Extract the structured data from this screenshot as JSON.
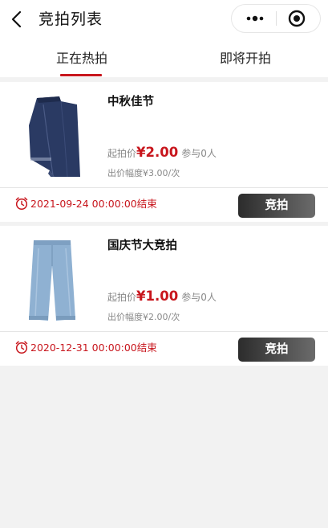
{
  "nav": {
    "title": "竞拍列表"
  },
  "tabs": [
    {
      "label": "正在热拍",
      "active": true
    },
    {
      "label": "即将开拍",
      "active": false
    }
  ],
  "items": [
    {
      "name": "中秋佳节",
      "start_price_label": "起拍价",
      "price": "¥2.00",
      "participants": "参与0人",
      "increment": "出价幅度¥3.00/次",
      "end_time": "2021-09-24 00:00:00结束",
      "bid_label": "竞拍",
      "image_icon": "dark-denim-skirt-image"
    },
    {
      "name": "国庆节大竞拍",
      "start_price_label": "起拍价",
      "price": "¥1.00",
      "participants": "参与0人",
      "increment": "出价幅度¥2.00/次",
      "end_time": "2020-12-31 00:00:00结束",
      "bid_label": "竞拍",
      "image_icon": "light-jeans-image"
    }
  ],
  "colors": {
    "accent": "#c8161d",
    "background": "#f2f2f2",
    "bid_button_start": "#2c2c2c",
    "bid_button_end": "#6b6b6b"
  }
}
